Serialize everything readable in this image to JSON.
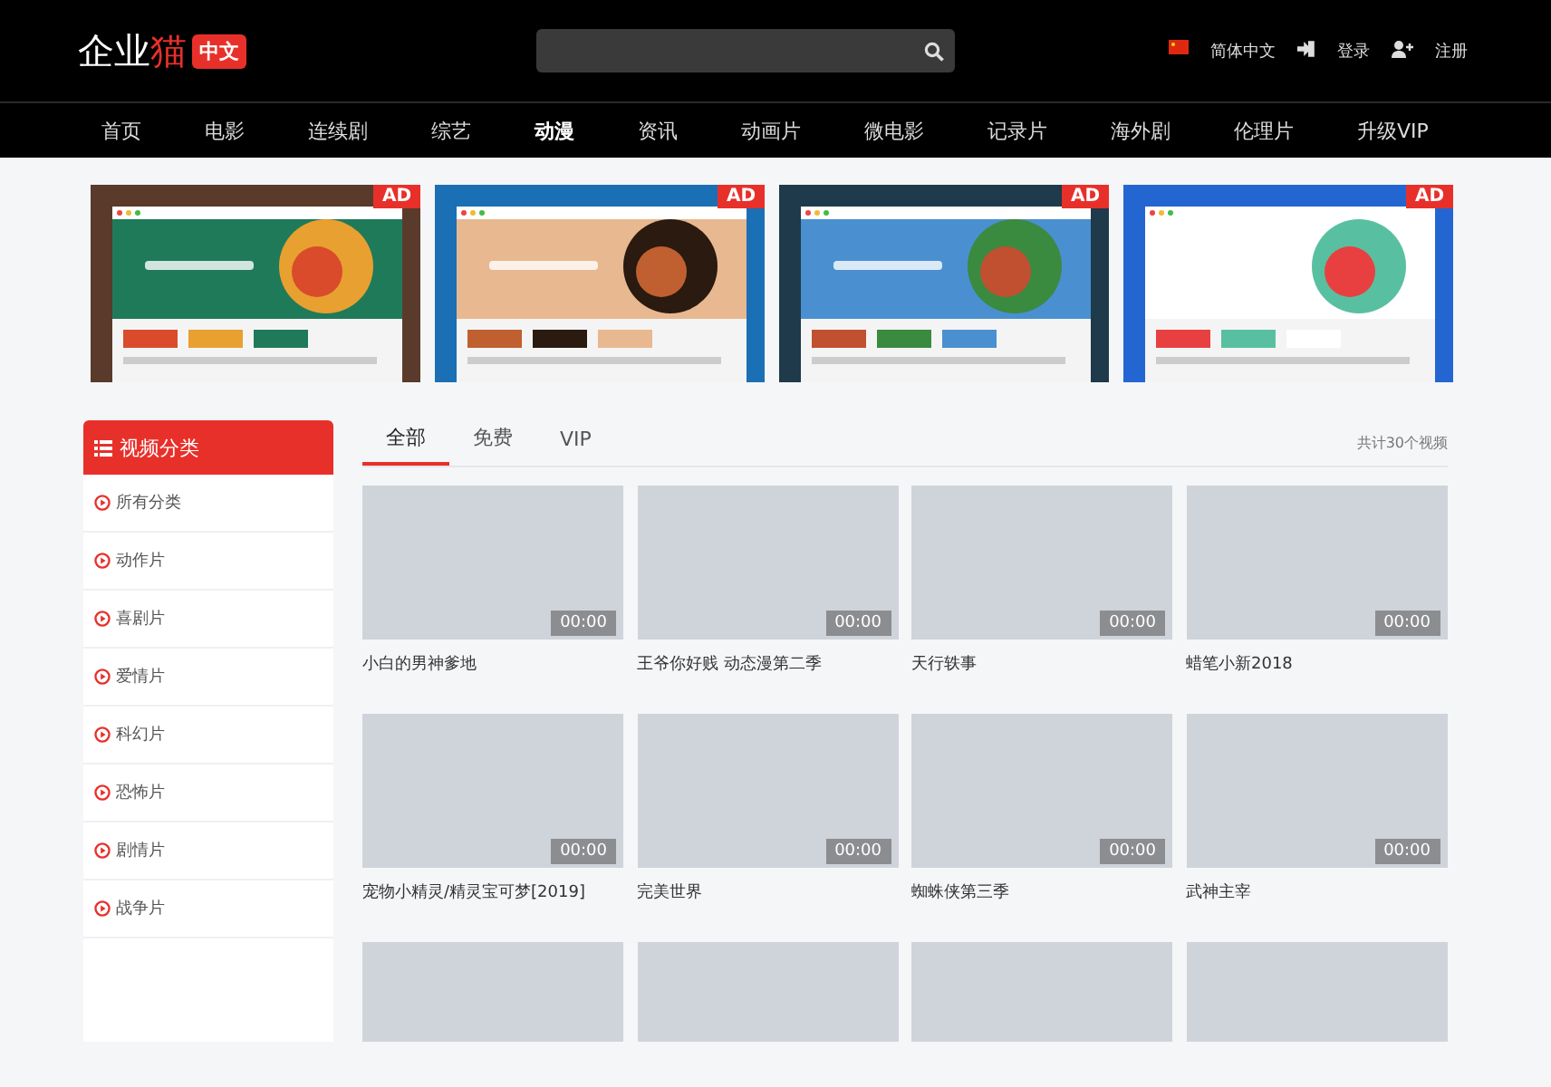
{
  "header": {
    "logo": {
      "text": "企业",
      "accent": "猫",
      "badge": "中文"
    },
    "links": [
      {
        "kind": "language",
        "label": "简体中文"
      },
      {
        "kind": "login",
        "label": "登录"
      },
      {
        "kind": "register",
        "label": "注册"
      }
    ]
  },
  "nav": [
    {
      "label": "首页",
      "selected": false
    },
    {
      "label": "电影",
      "selected": false
    },
    {
      "label": "连续剧",
      "selected": false
    },
    {
      "label": "综艺",
      "selected": false
    },
    {
      "label": "动漫",
      "selected": true
    },
    {
      "label": "资讯",
      "selected": false
    },
    {
      "label": "动画片",
      "selected": false
    },
    {
      "label": "微电影",
      "selected": false
    },
    {
      "label": "记录片",
      "selected": false
    },
    {
      "label": "海外剧",
      "selected": false
    },
    {
      "label": "伦理片",
      "selected": false
    },
    {
      "label": "升级VIP",
      "selected": false
    }
  ],
  "banners": [
    {
      "kind": "picture",
      "badge": "AD"
    },
    {
      "kind": "picture",
      "badge": "AD"
    },
    {
      "kind": "picture",
      "badge": "AD"
    },
    {
      "kind": "picture",
      "badge": "AD"
    }
  ],
  "sidebar": {
    "title": "视频分类",
    "items": [
      "所有分类",
      "动作片",
      "喜剧片",
      "爱情片",
      "科幻片",
      "恐怖片",
      "剧情片",
      "战争片"
    ]
  },
  "tabs": [
    {
      "label": "全部",
      "selected": true
    },
    {
      "label": "免费",
      "selected": false
    },
    {
      "label": "VIP",
      "selected": false
    }
  ],
  "total": "共计30个视频",
  "videos": [
    {
      "kind": "video",
      "title": "小白的男神爹地",
      "duration": "00:00"
    },
    {
      "kind": "video",
      "title": "王爷你好贱 动态漫第二季",
      "duration": "00:00"
    },
    {
      "kind": "video",
      "title": "天行轶事",
      "duration": "00:00"
    },
    {
      "kind": "video",
      "title": "蜡笔小新2018",
      "duration": "00:00"
    },
    {
      "kind": "video",
      "title": "宠物小精灵/精灵宝可梦[2019]",
      "duration": "00:00"
    },
    {
      "kind": "video",
      "title": "完美世界",
      "duration": "00:00"
    },
    {
      "kind": "video",
      "title": "蜘蛛侠第三季",
      "duration": "00:00"
    },
    {
      "kind": "video",
      "title": "武神主宰",
      "duration": "00:00"
    },
    {
      "kind": "thumb"
    },
    {
      "kind": "thumb"
    },
    {
      "kind": "thumb"
    },
    {
      "kind": "thumb"
    }
  ]
}
